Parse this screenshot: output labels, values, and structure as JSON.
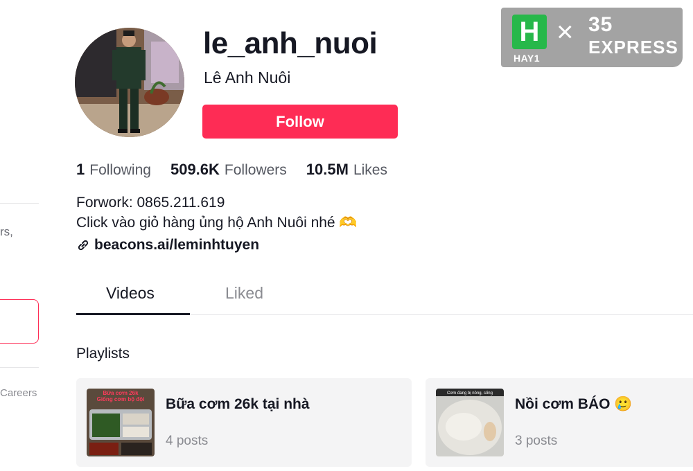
{
  "sidebar": {
    "fragment_text": "rs,",
    "careers": "Careers"
  },
  "profile": {
    "username": "le_anh_nuoi",
    "nickname": "Lê Anh Nuôi",
    "follow_label": "Follow",
    "stats": [
      {
        "value": "1",
        "label": "Following"
      },
      {
        "value": "509.6K",
        "label": "Followers"
      },
      {
        "value": "10.5M",
        "label": "Likes"
      }
    ],
    "bio_line1": "Forwork: 0865.211.619",
    "bio_line2": "Click vào giỏ hàng ủng hộ Anh Nuôi nhé 🫶",
    "link": "beacons.ai/leminhtuyen"
  },
  "tabs": [
    {
      "label": "Videos",
      "active": true
    },
    {
      "label": "Liked",
      "active": false
    }
  ],
  "playlists": {
    "heading": "Playlists",
    "items": [
      {
        "title": "Bữa cơm 26k tại nhà",
        "count": "4 posts",
        "thumb_caption1": "Bữa cơm 26k",
        "thumb_caption2": "Giống cơm bộ đội"
      },
      {
        "title": "Nồi cơm BÁO 🥲",
        "count": "3 posts",
        "thumb_caption1": "Cơm đang bị nồng, sống"
      }
    ]
  },
  "watermark": {
    "logo_letter": "H",
    "brand1": "HAY1",
    "separator": "×",
    "brand2_line1": "35",
    "brand2_line2": "EXPRESS"
  },
  "colors": {
    "accent": "#fe2c55",
    "text": "#161823",
    "muted": "#8a8b91"
  }
}
